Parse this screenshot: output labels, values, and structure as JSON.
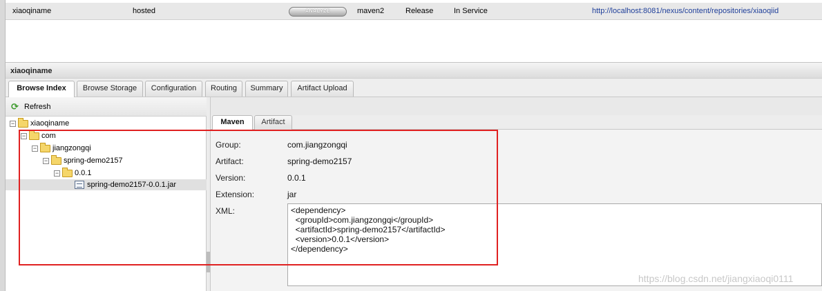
{
  "repo_row": {
    "name": "xiaoqiname",
    "type": "hosted",
    "analyze_label": "ANALYZE",
    "format": "maven2",
    "policy": "Release",
    "status": "In Service",
    "url": "http://localhost:8081/nexus/content/repositories/xiaoqiid"
  },
  "panel": {
    "title": "xiaoqiname",
    "tabs": [
      {
        "label": "Browse Index",
        "active": true
      },
      {
        "label": "Browse Storage"
      },
      {
        "label": "Configuration"
      },
      {
        "label": "Routing"
      },
      {
        "label": "Summary"
      },
      {
        "label": "Artifact Upload"
      }
    ]
  },
  "tree": {
    "refresh_label": "Refresh",
    "nodes": [
      {
        "label": "xiaoqiname",
        "depth": 0,
        "kind": "folder",
        "toggle": "⊟"
      },
      {
        "label": "com",
        "depth": 1,
        "kind": "folder",
        "toggle": "⊟"
      },
      {
        "label": "jiangzongqi",
        "depth": 2,
        "kind": "folder",
        "toggle": "⊟"
      },
      {
        "label": "spring-demo2157",
        "depth": 3,
        "kind": "folder",
        "toggle": "⊟"
      },
      {
        "label": "0.0.1",
        "depth": 4,
        "kind": "folder",
        "toggle": "⊟"
      },
      {
        "label": "spring-demo2157-0.0.1.jar",
        "depth": 5,
        "kind": "file",
        "selected": true
      }
    ]
  },
  "detail": {
    "tabs": [
      {
        "label": "Maven",
        "active": true
      },
      {
        "label": "Artifact"
      }
    ],
    "fields": {
      "group_label": "Group:",
      "group_value": "com.jiangzongqi",
      "artifact_label": "Artifact:",
      "artifact_value": "spring-demo2157",
      "version_label": "Version:",
      "version_value": "0.0.1",
      "extension_label": "Extension:",
      "extension_value": "jar",
      "xml_label": "XML:",
      "xml_value": "<dependency>\n  <groupId>com.jiangzongqi</groupId>\n  <artifactId>spring-demo2157</artifactId>\n  <version>0.0.1</version>\n</dependency>"
    }
  },
  "watermark": "https://blog.csdn.net/jiangxiaoqi0111",
  "colors": {
    "annotation": "#e02020",
    "url": "#1f3f9a"
  }
}
